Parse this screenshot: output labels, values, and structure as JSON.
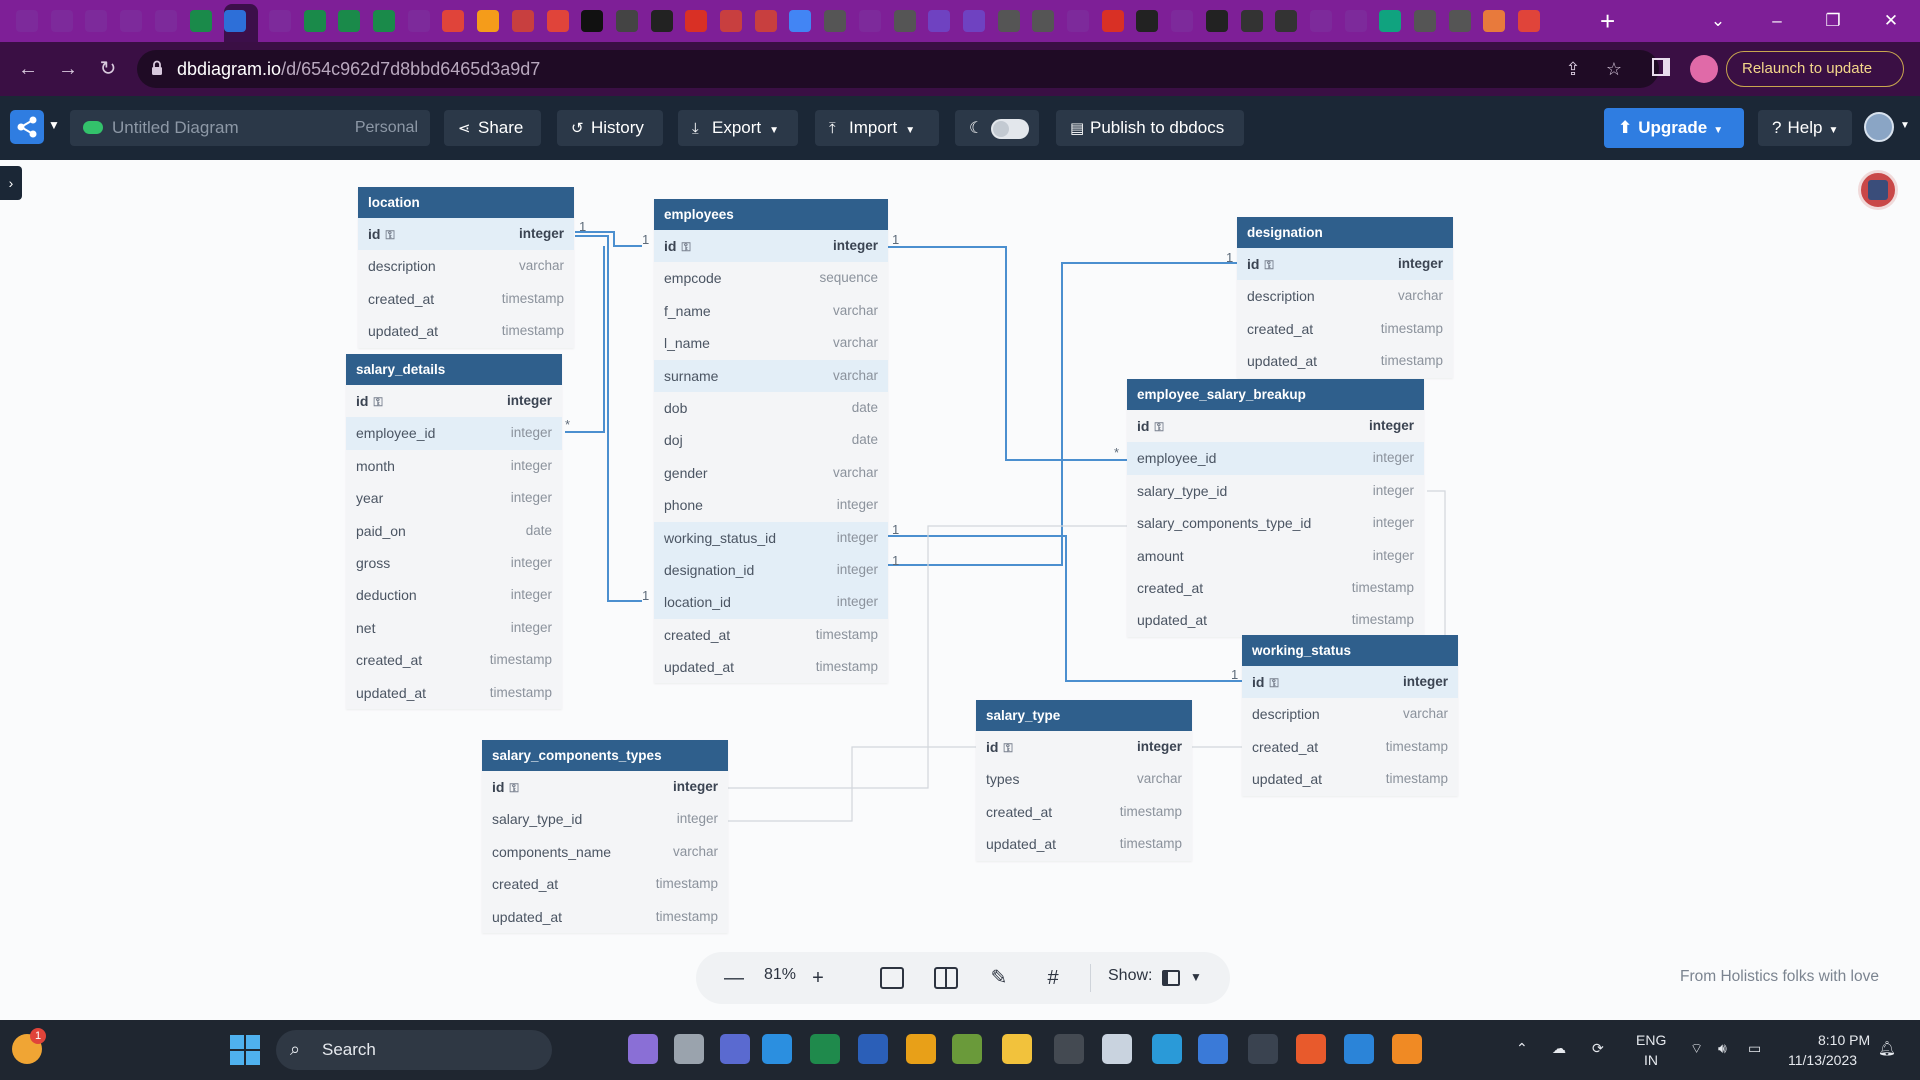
{
  "browser": {
    "url_host": "dbdiagram.io",
    "url_path": "/d/654c962d7d8bbd6465d3a9d7",
    "relaunch_label": "Relaunch to update",
    "new_tab_symbol": "+"
  },
  "toolbar": {
    "diagram_title": "Untitled Diagram",
    "diagram_scope": "Personal",
    "share_label": "Share",
    "history_label": "History",
    "export_label": "Export",
    "import_label": "Import",
    "publish_label": "Publish to dbdocs",
    "upgrade_label": "Upgrade",
    "help_label": "Help"
  },
  "tables": [
    {
      "name": "location",
      "fields": [
        {
          "name": "id",
          "type": "integer",
          "pk": true
        },
        {
          "name": "description",
          "type": "varchar"
        },
        {
          "name": "created_at",
          "type": "timestamp"
        },
        {
          "name": "updated_at",
          "type": "timestamp"
        }
      ]
    },
    {
      "name": "employees",
      "fields": [
        {
          "name": "id",
          "type": "integer",
          "pk": true
        },
        {
          "name": "empcode",
          "type": "sequence"
        },
        {
          "name": "f_name",
          "type": "varchar"
        },
        {
          "name": "l_name",
          "type": "varchar"
        },
        {
          "name": "surname",
          "type": "varchar"
        },
        {
          "name": "dob",
          "type": "date"
        },
        {
          "name": "doj",
          "type": "date"
        },
        {
          "name": "gender",
          "type": "varchar"
        },
        {
          "name": "phone",
          "type": "integer"
        },
        {
          "name": "working_status_id",
          "type": "integer"
        },
        {
          "name": "designation_id",
          "type": "integer"
        },
        {
          "name": "location_id",
          "type": "integer"
        },
        {
          "name": "created_at",
          "type": "timestamp"
        },
        {
          "name": "updated_at",
          "type": "timestamp"
        }
      ]
    },
    {
      "name": "designation",
      "fields": [
        {
          "name": "id",
          "type": "integer",
          "pk": true
        },
        {
          "name": "description",
          "type": "varchar"
        },
        {
          "name": "created_at",
          "type": "timestamp"
        },
        {
          "name": "updated_at",
          "type": "timestamp"
        }
      ]
    },
    {
      "name": "salary_details",
      "fields": [
        {
          "name": "id",
          "type": "integer",
          "pk": true
        },
        {
          "name": "employee_id",
          "type": "integer"
        },
        {
          "name": "month",
          "type": "integer"
        },
        {
          "name": "year",
          "type": "integer"
        },
        {
          "name": "paid_on",
          "type": "date"
        },
        {
          "name": "gross",
          "type": "integer"
        },
        {
          "name": "deduction",
          "type": "integer"
        },
        {
          "name": "net",
          "type": "integer"
        },
        {
          "name": "created_at",
          "type": "timestamp"
        },
        {
          "name": "updated_at",
          "type": "timestamp"
        }
      ]
    },
    {
      "name": "employee_salary_breakup",
      "fields": [
        {
          "name": "id",
          "type": "integer",
          "pk": true
        },
        {
          "name": "employee_id",
          "type": "integer"
        },
        {
          "name": "salary_type_id",
          "type": "integer"
        },
        {
          "name": "salary_components_type_id",
          "type": "integer"
        },
        {
          "name": "amount",
          "type": "integer"
        },
        {
          "name": "created_at",
          "type": "timestamp"
        },
        {
          "name": "updated_at",
          "type": "timestamp"
        }
      ]
    },
    {
      "name": "working_status",
      "fields": [
        {
          "name": "id",
          "type": "integer",
          "pk": true
        },
        {
          "name": "description",
          "type": "varchar"
        },
        {
          "name": "created_at",
          "type": "timestamp"
        },
        {
          "name": "updated_at",
          "type": "timestamp"
        }
      ]
    },
    {
      "name": "salary_type",
      "fields": [
        {
          "name": "id",
          "type": "integer",
          "pk": true
        },
        {
          "name": "types",
          "type": "varchar"
        },
        {
          "name": "created_at",
          "type": "timestamp"
        },
        {
          "name": "updated_at",
          "type": "timestamp"
        }
      ]
    },
    {
      "name": "salary_components_types",
      "fields": [
        {
          "name": "id",
          "type": "integer",
          "pk": true
        },
        {
          "name": "salary_type_id",
          "type": "integer"
        },
        {
          "name": "components_name",
          "type": "varchar"
        },
        {
          "name": "created_at",
          "type": "timestamp"
        },
        {
          "name": "updated_at",
          "type": "timestamp"
        }
      ]
    }
  ],
  "relationship_marks": {
    "one": "1",
    "many": "*"
  },
  "zoombar": {
    "zoom_level": "81%",
    "show_label": "Show:"
  },
  "footer": "From Holistics folks with love",
  "taskbar": {
    "search_label": "Search",
    "notification_count": "1",
    "lang_top": "ENG",
    "lang_bottom": "IN",
    "time": "8:10 PM",
    "date": "11/13/2023"
  },
  "colors": {
    "tab_strip": "#7e1f97",
    "address_bar": "#3a0f44",
    "app_toolbar": "#1b2736",
    "table_header": "#2f5f8c",
    "upgrade": "#2f7de1",
    "connector": "#4b8fcf"
  }
}
